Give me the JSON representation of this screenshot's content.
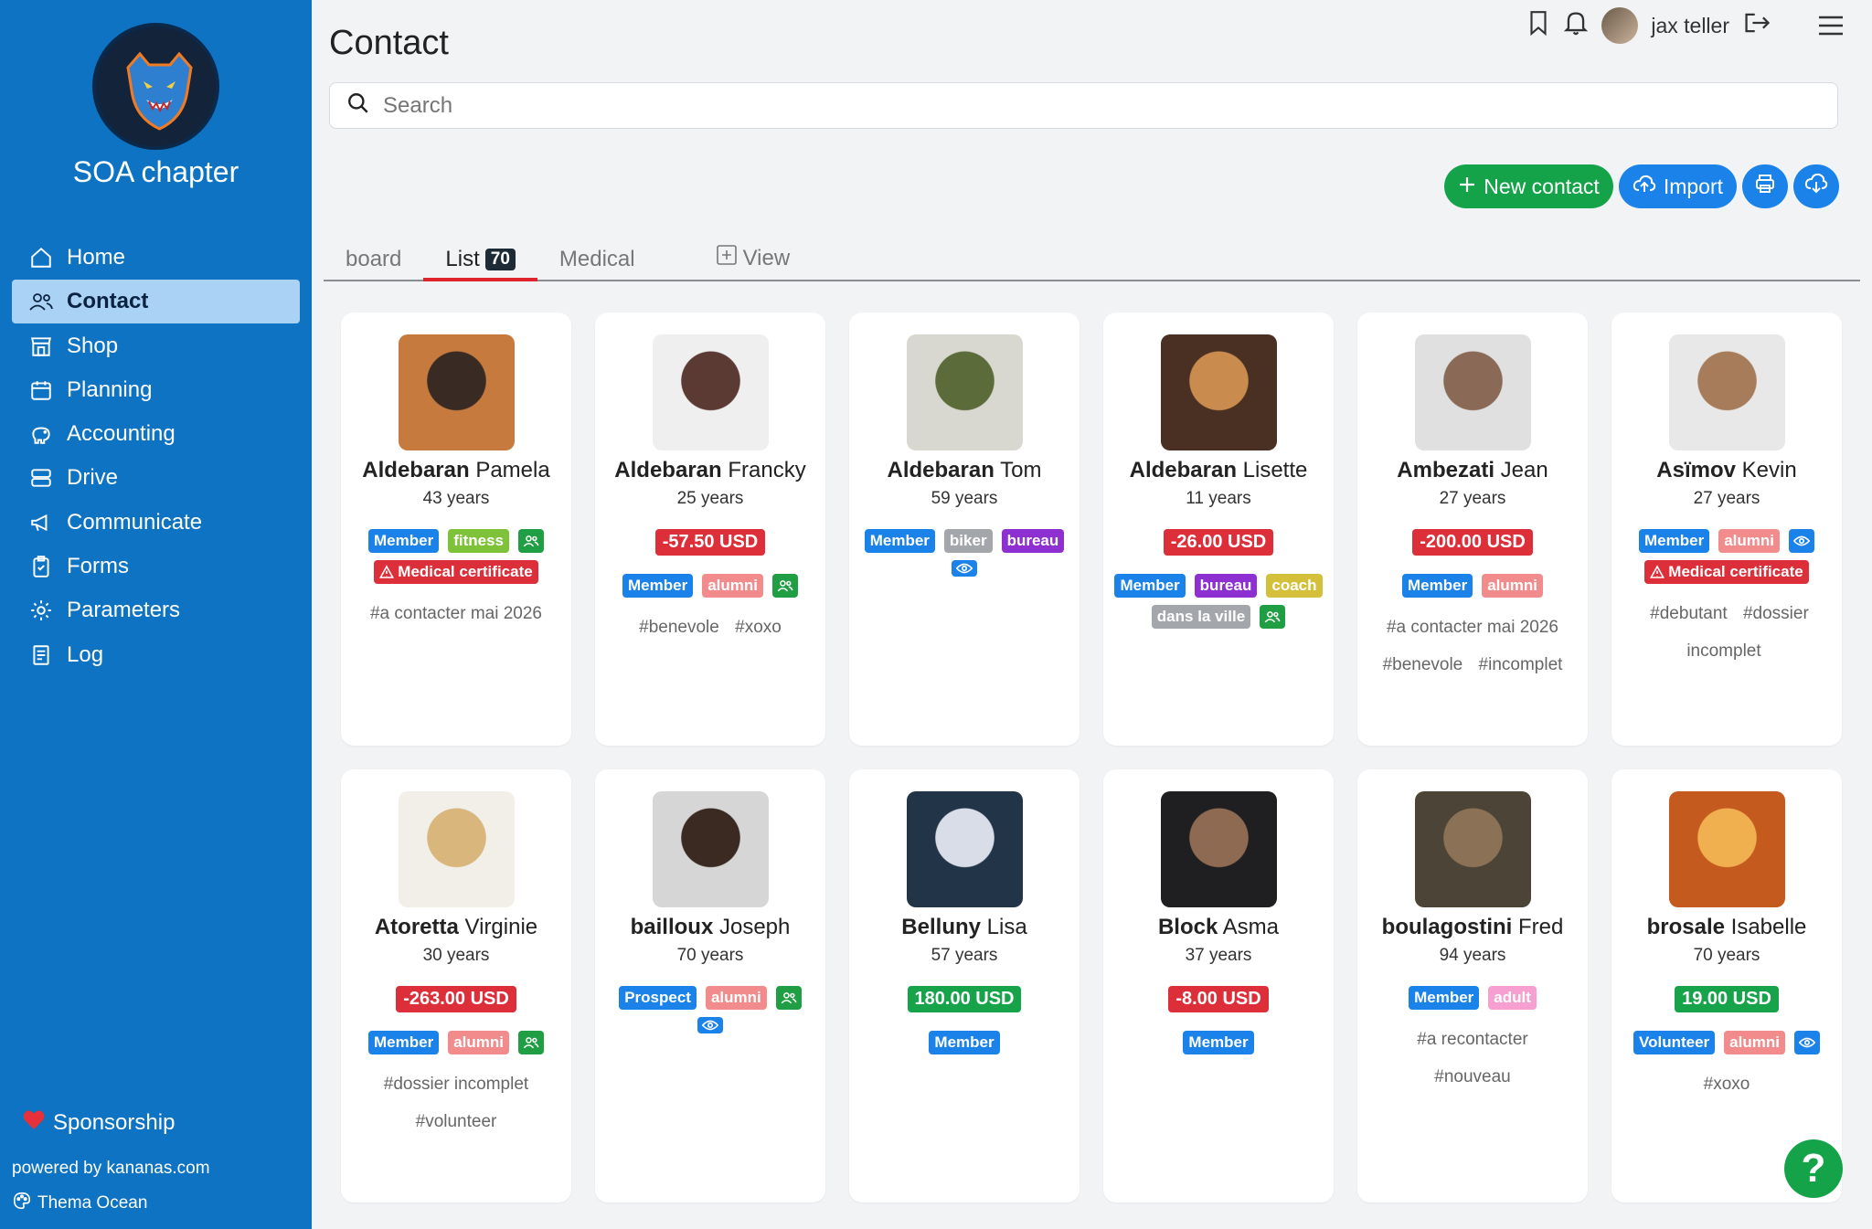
{
  "sidebar": {
    "chapter_name": "SOA chapter",
    "nav": [
      {
        "label": "Home",
        "icon": "home-icon"
      },
      {
        "label": "Contact",
        "icon": "users-icon",
        "active": true
      },
      {
        "label": "Shop",
        "icon": "shop-icon"
      },
      {
        "label": "Planning",
        "icon": "calendar-icon"
      },
      {
        "label": "Accounting",
        "icon": "piggy-bank-icon"
      },
      {
        "label": "Drive",
        "icon": "drive-icon"
      },
      {
        "label": "Communicate",
        "icon": "megaphone-icon"
      },
      {
        "label": "Forms",
        "icon": "clipboard-icon"
      },
      {
        "label": "Parameters",
        "icon": "gear-icon"
      },
      {
        "label": "Log",
        "icon": "log-icon"
      }
    ],
    "sponsorship": "Sponsorship",
    "powered_by": "powered by kananas.com",
    "theme": "Thema Ocean"
  },
  "header": {
    "title": "Contact",
    "user_name": "jax teller",
    "search_placeholder": "Search"
  },
  "actions": {
    "new_contact": "New contact",
    "import": "Import"
  },
  "tabs": [
    {
      "label": "board"
    },
    {
      "label": "List",
      "count": "70",
      "active": true
    },
    {
      "label": "Medical"
    },
    {
      "label": "View"
    }
  ],
  "colors": {
    "sidebar": "#0d73c2",
    "member": "#1a82e8",
    "alumni": "#f28b8b",
    "fitness": "#7ec23a",
    "biker": "#a3a6aa",
    "bureau": "#8d2fd1",
    "coach": "#d4c03a",
    "ville": "#a3a6aa",
    "adult": "#f5a0d0",
    "prospect": "#1a82e8",
    "volunteer": "#1a82e8",
    "group": "#1f9e43",
    "medical": "#dc2f39",
    "negative": "#dc2f39",
    "positive": "#16a34a"
  },
  "contacts": [
    {
      "last": "Aldebaran",
      "first": "Pamela",
      "age": "43 years",
      "amount": "",
      "badges": [
        {
          "t": "Member",
          "c": "#1a82e8"
        },
        {
          "t": "fitness",
          "c": "#7ec23a"
        },
        {
          "t": "",
          "c": "#1f9e43",
          "icon": "group-icon"
        },
        {
          "t": "Medical certificate",
          "c": "#dc2f39",
          "icon": "warning-icon"
        }
      ],
      "tags": [
        "#a contacter mai 2026"
      ],
      "photo": [
        "#c77a3d",
        "#3a2a24"
      ]
    },
    {
      "last": "Aldebaran",
      "first": "Francky",
      "age": "25 years",
      "amount": "-57.50 USD",
      "neg": true,
      "badges": [
        {
          "t": "Member",
          "c": "#1a82e8"
        },
        {
          "t": "alumni",
          "c": "#f28b8b"
        },
        {
          "t": "",
          "c": "#1f9e43",
          "icon": "group-icon"
        }
      ],
      "tags": [
        "#benevole",
        "#xoxo"
      ],
      "photo": [
        "#efefef",
        "#5a3a32"
      ]
    },
    {
      "last": "Aldebaran",
      "first": "Tom",
      "age": "59 years",
      "amount": "",
      "badges": [
        {
          "t": "Member",
          "c": "#1a82e8"
        },
        {
          "t": "biker",
          "c": "#a3a6aa"
        },
        {
          "t": "bureau",
          "c": "#8d2fd1"
        },
        {
          "t": "",
          "c": "#1a82e8",
          "icon": "eye-icon"
        }
      ],
      "tags": [],
      "photo": [
        "#d8d8d0",
        "#5b6b3a"
      ]
    },
    {
      "last": "Aldebaran",
      "first": "Lisette",
      "age": "11 years",
      "amount": "-26.00 USD",
      "neg": true,
      "badges": [
        {
          "t": "Member",
          "c": "#1a82e8"
        },
        {
          "t": "bureau",
          "c": "#8d2fd1"
        },
        {
          "t": "coach",
          "c": "#d4c03a"
        },
        {
          "t": "dans la ville",
          "c": "#a3a6aa"
        },
        {
          "t": "",
          "c": "#1f9e43",
          "icon": "group-icon"
        }
      ],
      "tags": [],
      "photo": [
        "#4a3022",
        "#c98b4e"
      ]
    },
    {
      "last": "Ambezati",
      "first": "Jean",
      "age": "27 years",
      "amount": "-200.00 USD",
      "neg": true,
      "badges": [
        {
          "t": "Member",
          "c": "#1a82e8"
        },
        {
          "t": "alumni",
          "c": "#f28b8b"
        }
      ],
      "tags": [
        "#a contacter mai 2026",
        "#benevole",
        "#incomplet"
      ],
      "photo": [
        "#e0e0e0",
        "#8a6a56"
      ]
    },
    {
      "last": "Asïmov",
      "first": "Kevin",
      "age": "27 years",
      "amount": "",
      "badges": [
        {
          "t": "Member",
          "c": "#1a82e8"
        },
        {
          "t": "alumni",
          "c": "#f28b8b"
        },
        {
          "t": "",
          "c": "#1a82e8",
          "icon": "eye-icon"
        },
        {
          "t": "Medical certificate",
          "c": "#dc2f39",
          "icon": "warning-icon"
        }
      ],
      "tags": [
        "#debutant",
        "#dossier incomplet"
      ],
      "photo": [
        "#e8e8e8",
        "#a67c5a"
      ]
    },
    {
      "last": "Atoretta",
      "first": "Virginie",
      "age": "30 years",
      "amount": "-263.00 USD",
      "neg": true,
      "badges": [
        {
          "t": "Member",
          "c": "#1a82e8"
        },
        {
          "t": "alumni",
          "c": "#f28b8b"
        },
        {
          "t": "",
          "c": "#1f9e43",
          "icon": "group-icon"
        }
      ],
      "tags": [
        "#dossier incomplet",
        "#volunteer"
      ],
      "photo": [
        "#f1efe8",
        "#d9b77c"
      ]
    },
    {
      "last": "bailloux",
      "first": "Joseph",
      "age": "70 years",
      "amount": "",
      "badges": [
        {
          "t": "Prospect",
          "c": "#1a82e8"
        },
        {
          "t": "alumni",
          "c": "#f28b8b"
        },
        {
          "t": "",
          "c": "#1f9e43",
          "icon": "group-icon"
        },
        {
          "t": "",
          "c": "#1a82e8",
          "icon": "eye-icon"
        }
      ],
      "tags": [],
      "photo": [
        "#d6d6d6",
        "#3b2a22"
      ]
    },
    {
      "last": "Belluny",
      "first": "Lisa",
      "age": "57 years",
      "amount": "180.00 USD",
      "neg": false,
      "badges": [
        {
          "t": "Member",
          "c": "#1a82e8"
        }
      ],
      "tags": [],
      "photo": [
        "#223448",
        "#d9dde8"
      ]
    },
    {
      "last": "Block",
      "first": "Asma",
      "age": "37 years",
      "amount": "-8.00 USD",
      "neg": true,
      "badges": [
        {
          "t": "Member",
          "c": "#1a82e8"
        }
      ],
      "tags": [],
      "photo": [
        "#1f1f22",
        "#8f6a52"
      ]
    },
    {
      "last": "boulagostini",
      "first": "Fred",
      "age": "94 years",
      "amount": "",
      "badges": [
        {
          "t": "Member",
          "c": "#1a82e8"
        },
        {
          "t": "adult",
          "c": "#f5a0d0"
        }
      ],
      "tags": [
        "#a recontacter",
        "#nouveau"
      ],
      "photo": [
        "#4c4436",
        "#8b7256"
      ]
    },
    {
      "last": "brosale",
      "first": "Isabelle",
      "age": "70 years",
      "amount": "19.00 USD",
      "neg": false,
      "badges": [
        {
          "t": "Volunteer",
          "c": "#1a82e8"
        },
        {
          "t": "alumni",
          "c": "#f28b8b"
        },
        {
          "t": "",
          "c": "#1a82e8",
          "icon": "eye-icon"
        }
      ],
      "tags": [
        "#xoxo"
      ],
      "photo": [
        "#c45a1e",
        "#f0b050"
      ]
    }
  ],
  "help_label": "?"
}
